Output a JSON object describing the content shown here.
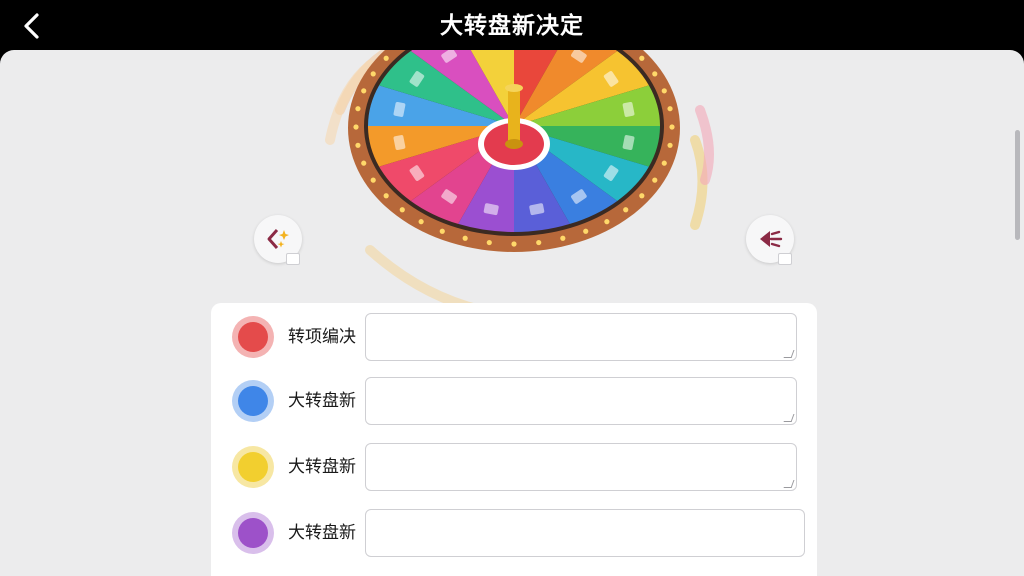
{
  "header": {
    "title": "大转盘新决定",
    "back_icon": "chevron-left-icon"
  },
  "wheel": {
    "segment_colors": [
      "#e9473b",
      "#f08a2c",
      "#f6c330",
      "#8ccf3a",
      "#36b35b",
      "#27b7c7",
      "#3a7fe0",
      "#5a5fd8",
      "#9b4fd1",
      "#e2448f",
      "#ef4a6a",
      "#f39a2a",
      "#4aa3e8",
      "#2fc08a",
      "#d94fbf",
      "#f3d13a"
    ],
    "rim_color": "#b7683a",
    "hub_color": "#e33b4e",
    "pointer_color": "#e8b31c"
  },
  "side_buttons": {
    "left_icon": "magic-sparkle-icon",
    "right_icon": "share-back-icon",
    "accent": "#8b2a45"
  },
  "options": [
    {
      "label": "转项编决",
      "value": "",
      "color": "#e44b4b",
      "ring": "#f4b3b3"
    },
    {
      "label": "大转盘新",
      "value": "",
      "color": "#3f86e8",
      "ring": "#b3cff5"
    },
    {
      "label": "大转盘新",
      "value": "",
      "color": "#f2cf2f",
      "ring": "#f7e7a3"
    },
    {
      "label": "大转盘新",
      "value": "",
      "color": "#9d51c9",
      "ring": "#d9bfeb"
    }
  ]
}
